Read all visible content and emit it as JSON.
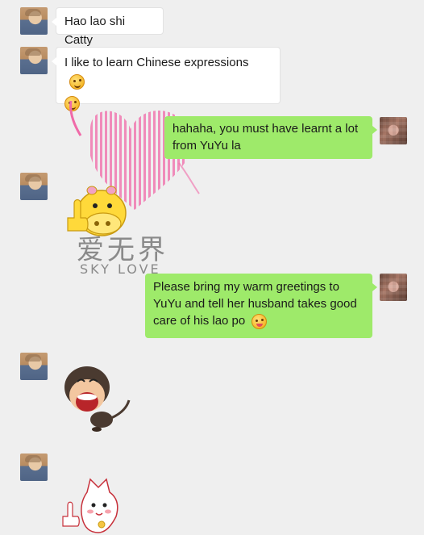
{
  "messages": [
    {
      "side": "left",
      "text": "Hao lao shi Catty"
    },
    {
      "side": "left",
      "text": "I like to learn Chinese expressions",
      "emoji_after": "wink-emoji",
      "emoji_line2": "wink-emoji"
    },
    {
      "side": "right",
      "line1": "hahaha, you must have learnt a lot",
      "line2": "from YuYu la"
    },
    {
      "side": "left",
      "sticker": "hippo-thumbs-up-sticker"
    },
    {
      "side": "right",
      "line1": "Please bring my warm greetings to",
      "line2": "YuYu and tell her husband takes good",
      "line3": "care of his lao po",
      "emoji_after": "tongue-out-emoji"
    },
    {
      "side": "left",
      "sticker": "laughing-monkey-sticker"
    },
    {
      "side": "left",
      "sticker": "cat-thumbs-up-sticker"
    }
  ],
  "watermark": {
    "chinese": "爱无界",
    "english": "SKY LOVE"
  },
  "colors": {
    "background": "#efefef",
    "bubble_left": "#ffffff",
    "bubble_right": "#9eea6a",
    "heart": "#f06aa8"
  }
}
